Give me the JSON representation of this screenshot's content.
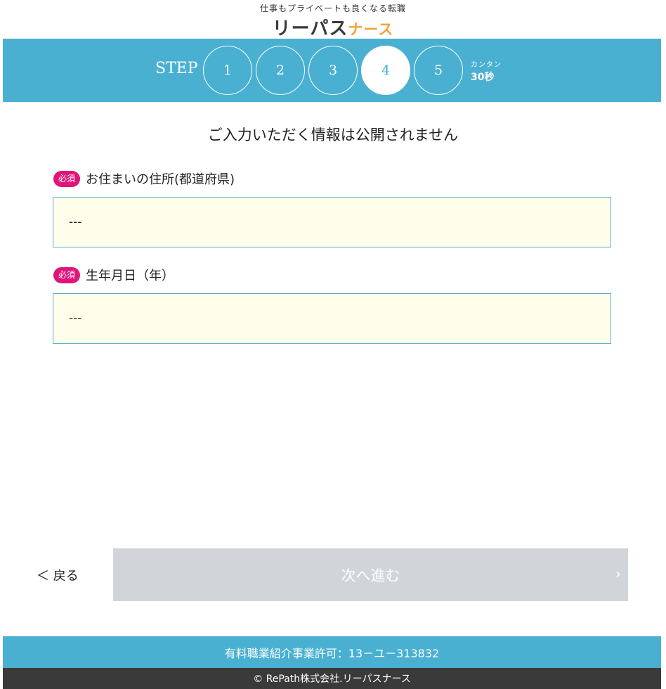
{
  "header": {
    "tagline": "仕事もプライベートも良くなる転職",
    "logo_main": "リーパス",
    "logo_accent": "ナース"
  },
  "steps": {
    "label": "STEP",
    "items": [
      "1",
      "2",
      "3",
      "4",
      "5"
    ],
    "current": "4",
    "note_small": "カンタン",
    "note_big": "30秒"
  },
  "notice": "ご入力いただく情報は公開されません",
  "fields": [
    {
      "badge": "必須",
      "label": "お住まいの住所(都道府県)",
      "value": "---"
    },
    {
      "badge": "必須",
      "label": "生年月日（年）",
      "value": "---"
    }
  ],
  "nav": {
    "back_label": "＜ 戻る",
    "next_label": "次へ進む",
    "next_chevron": "›"
  },
  "footer": {
    "license": "有料職業紹介事業許可：13－ユ－313832",
    "copyright": "© RePath株式会社.リーパスナース"
  },
  "colors": {
    "brand_blue": "#4ab0d2",
    "accent_orange": "#f0a43a",
    "required_pink": "#e0157a",
    "input_bg": "#fefeea",
    "disabled_button": "#d1d5da",
    "footer_dark": "#3a3a3a"
  }
}
